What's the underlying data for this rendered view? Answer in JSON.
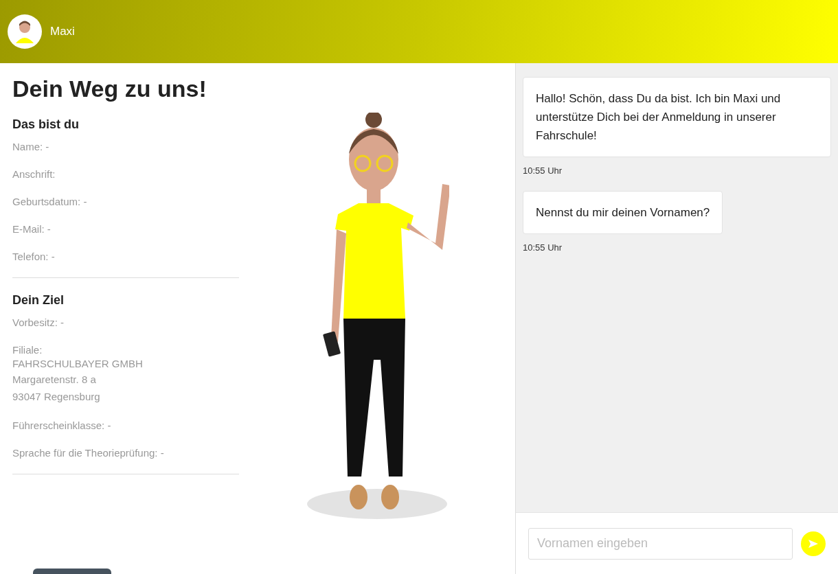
{
  "header": {
    "bot_name": "Maxi"
  },
  "title": "Dein Weg zu uns!",
  "sections": [
    {
      "heading": "Das bist du",
      "fields": [
        {
          "lines": [
            "Name: -"
          ]
        },
        {
          "lines": [
            "Anschrift:"
          ]
        },
        {
          "lines": [
            "Geburtsdatum: -"
          ]
        },
        {
          "lines": [
            "E-Mail: -"
          ]
        },
        {
          "lines": [
            "Telefon: -"
          ]
        }
      ]
    },
    {
      "heading": "Dein Ziel",
      "fields": [
        {
          "lines": [
            "Vorbesitz: -"
          ]
        },
        {
          "lines": [
            "Filiale:",
            "FAHRSCHULBAYER GMBH",
            "Margaretenstr. 8 a",
            "93047 Regensburg"
          ]
        },
        {
          "lines": [
            "Führerscheinklasse: -"
          ]
        },
        {
          "lines": [
            "Sprache für die Theorieprüfung: -"
          ]
        }
      ]
    }
  ],
  "chat": {
    "messages": [
      {
        "text": "Hallo! Schön, dass Du da bist. Ich bin Maxi und unterstütze Dich bei der Anmeldung in unserer Fahrschule!",
        "time": "10:55 Uhr"
      },
      {
        "text": "Nennst du mir deinen Vornamen?",
        "time": "10:55 Uhr"
      }
    ],
    "input": {
      "placeholder": "Vornamen eingeben"
    }
  }
}
